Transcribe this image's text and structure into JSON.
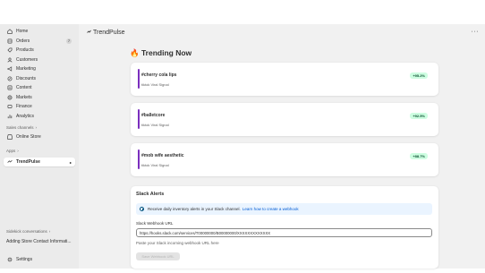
{
  "sidebar": {
    "items": [
      {
        "label": "Home",
        "icon": "home-icon"
      },
      {
        "label": "Orders",
        "icon": "orders-icon",
        "badge": "7"
      },
      {
        "label": "Products",
        "icon": "products-icon"
      },
      {
        "label": "Customers",
        "icon": "customers-icon"
      },
      {
        "label": "Marketing",
        "icon": "marketing-icon"
      },
      {
        "label": "Discounts",
        "icon": "discounts-icon"
      },
      {
        "label": "Content",
        "icon": "content-icon"
      },
      {
        "label": "Markets",
        "icon": "markets-icon"
      },
      {
        "label": "Finance",
        "icon": "finance-icon"
      },
      {
        "label": "Analytics",
        "icon": "analytics-icon"
      }
    ],
    "sales_channels_label": "Sales channels",
    "online_store_label": "Online Store",
    "apps_label": "Apps",
    "app_item_label": "TrendPulse",
    "sidekick_label": "Sidekick conversations",
    "sidekick_item": "Adding Store Contact Informati...",
    "settings_label": "Settings"
  },
  "appbar": {
    "title": "TrendPulse",
    "more_icon": "···"
  },
  "page": {
    "title": "🔥 Trending Now"
  },
  "trends": [
    {
      "name": "#cherry cola lips",
      "source": "tiktok Viral Signal",
      "change": "+95.2%"
    },
    {
      "name": "#balletcore",
      "source": "tiktok Viral Signal",
      "change": "+92.5%"
    },
    {
      "name": "#mob wife aesthetic",
      "source": "tiktok Viral Signal",
      "change": "+88.7%"
    }
  ],
  "slack": {
    "title": "Slack Alerts",
    "banner_text": "Receive daily inventory alerts in your Slack channel.",
    "banner_link": "Learn how to create a webhook",
    "field_label": "Slack Webhook URL",
    "field_value": "https://hooks.slack.com/services/T00000000/B00000000/XXXXXXXXXXXXX",
    "help_text": "Paste your Slack incoming webhook URL here",
    "save_label": "Save Webhook URL"
  },
  "colors": {
    "accent_bar": "#7b2fbe",
    "badge_bg": "#cdfee1",
    "link": "#005bd3"
  }
}
